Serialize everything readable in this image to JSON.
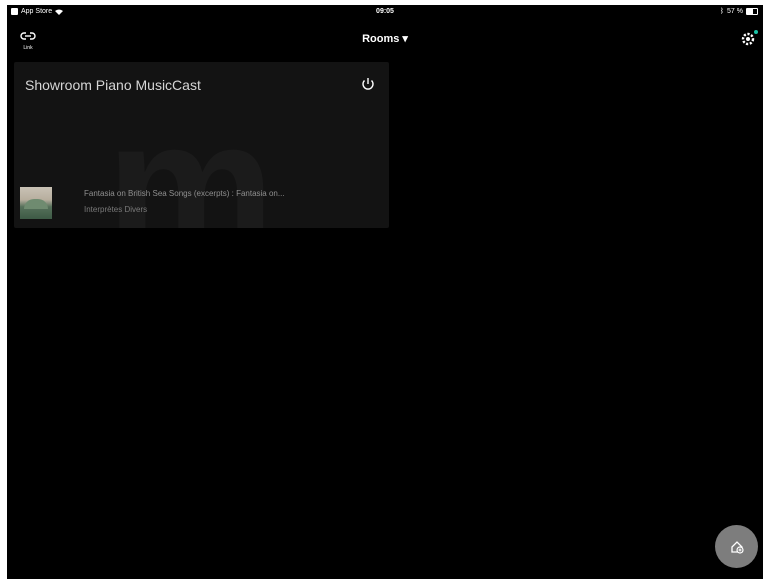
{
  "status_bar": {
    "carrier": "App Store",
    "time": "09:05",
    "battery": "57 %"
  },
  "nav": {
    "link_label": "Link",
    "title": "Rooms",
    "title_caret": "▾"
  },
  "room": {
    "name": "Showroom Piano MusicCast",
    "watermark": "m",
    "track_title": "Fantasia on British Sea Songs (excerpts) : Fantasia on...",
    "track_artist": "Interprètes Divers"
  },
  "colors": {
    "background": "#000000",
    "card": "#131313",
    "accent_dot": "#19c3a6",
    "fab": "#7d7d7d"
  },
  "icons": {
    "link": "link-icon",
    "settings": "gear-icon",
    "power": "power-icon",
    "fab": "add-room-icon"
  }
}
